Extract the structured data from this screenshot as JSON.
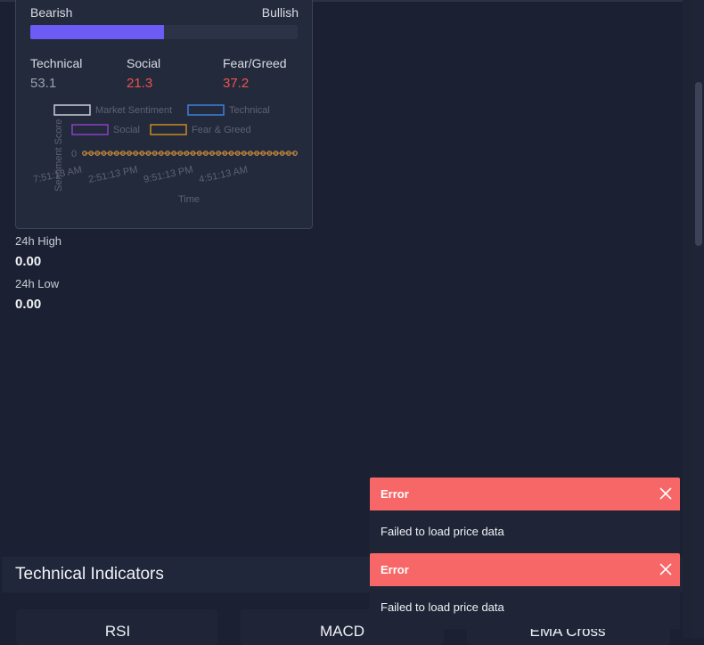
{
  "sentiment": {
    "bearish_label": "Bearish",
    "bullish_label": "Bullish",
    "bar_fill_fraction": 0.5,
    "bar_color": "#6c5cf5",
    "metrics": [
      {
        "label": "Technical",
        "value": "53.1",
        "color": "#9aa0ad"
      },
      {
        "label": "Social",
        "value": "21.3",
        "color": "#f0524e"
      },
      {
        "label": "Fear/Greed",
        "value": "37.2",
        "color": "#f0524e"
      }
    ]
  },
  "chart_data": {
    "type": "line",
    "legend": [
      "Market Sentiment",
      "Technical",
      "Social",
      "Fear & Greed"
    ],
    "legend_colors": [
      "#c9ccd6",
      "#3d7fd9",
      "#8b3fc4",
      "#c98a1e"
    ],
    "ylabel": "Sentiment Score",
    "xlabel": "Time",
    "y_tick_labels": [
      "0"
    ],
    "x_tick_labels": [
      "7:51:13 AM",
      "2:51:13 PM",
      "9:51:13 PM",
      "4:51:13 AM"
    ],
    "series": [
      {
        "name": "Market Sentiment",
        "values": [
          0,
          0,
          0,
          0,
          0,
          0,
          0,
          0,
          0,
          0,
          0,
          0,
          0,
          0,
          0,
          0,
          0,
          0,
          0,
          0,
          0,
          0,
          0,
          0,
          0,
          0,
          0,
          0,
          0,
          0,
          0,
          0,
          0,
          0
        ]
      },
      {
        "name": "Technical",
        "values": [
          0,
          0,
          0,
          0,
          0,
          0,
          0,
          0,
          0,
          0,
          0,
          0,
          0,
          0,
          0,
          0,
          0,
          0,
          0,
          0,
          0,
          0,
          0,
          0,
          0,
          0,
          0,
          0,
          0,
          0,
          0,
          0,
          0,
          0
        ]
      },
      {
        "name": "Social",
        "values": [
          0,
          0,
          0,
          0,
          0,
          0,
          0,
          0,
          0,
          0,
          0,
          0,
          0,
          0,
          0,
          0,
          0,
          0,
          0,
          0,
          0,
          0,
          0,
          0,
          0,
          0,
          0,
          0,
          0,
          0,
          0,
          0,
          0,
          0
        ]
      },
      {
        "name": "Fear & Greed",
        "values": [
          0,
          0,
          0,
          0,
          0,
          0,
          0,
          0,
          0,
          0,
          0,
          0,
          0,
          0,
          0,
          0,
          0,
          0,
          0,
          0,
          0,
          0,
          0,
          0,
          0,
          0,
          0,
          0,
          0,
          0,
          0,
          0,
          0,
          0
        ]
      }
    ]
  },
  "stats": {
    "high_label": "24h High",
    "high_value": "0.00",
    "low_label": "24h Low",
    "low_value": "0.00"
  },
  "technical_indicators": {
    "title": "Technical Indicators",
    "cards": [
      "RSI",
      "MACD",
      "EMA Cross"
    ]
  },
  "toasts": [
    {
      "title": "Error",
      "message": "Failed to load price data"
    },
    {
      "title": "Error",
      "message": "Failed to load price data"
    }
  ],
  "colors": {
    "background": "#1b2132",
    "toast_header": "#f86767"
  },
  "icons": {
    "toast_close": "close-icon"
  }
}
